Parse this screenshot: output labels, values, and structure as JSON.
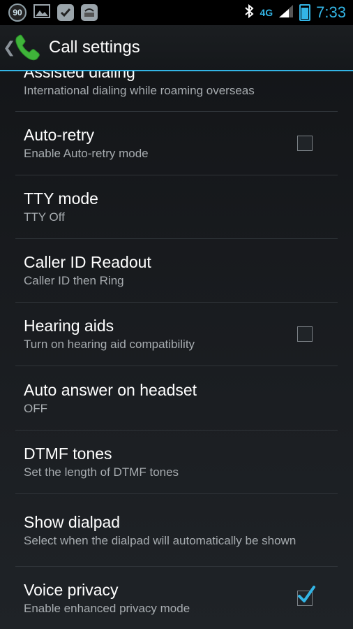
{
  "status_bar": {
    "notification_badge": "90",
    "network_label": "4G",
    "time": "7:33",
    "icons": [
      "counter-badge-icon",
      "gallery-icon",
      "check-bubble-icon",
      "media-app-icon",
      "bluetooth-icon",
      "network-icon",
      "signal-icon",
      "battery-icon"
    ]
  },
  "action_bar": {
    "title": "Call settings",
    "icon": "phone-icon"
  },
  "colors": {
    "accent": "#33b5e5",
    "phone_green": "#3fb43a"
  },
  "settings": [
    {
      "title": "Assisted dialing",
      "subtitle": "International dialing while roaming overseas",
      "checkbox": null
    },
    {
      "title": "Auto-retry",
      "subtitle": "Enable Auto-retry mode",
      "checkbox": false
    },
    {
      "title": "TTY mode",
      "subtitle": "TTY Off",
      "checkbox": null
    },
    {
      "title": "Caller ID Readout",
      "subtitle": "Caller ID then Ring",
      "checkbox": null
    },
    {
      "title": "Hearing aids",
      "subtitle": "Turn on hearing aid compatibility",
      "checkbox": false
    },
    {
      "title": "Auto answer on headset",
      "subtitle": "OFF",
      "checkbox": null
    },
    {
      "title": "DTMF tones",
      "subtitle": "Set the length of DTMF tones",
      "checkbox": null
    },
    {
      "title": "Show dialpad",
      "subtitle": "Select when the dialpad will automatically be shown",
      "checkbox": null
    },
    {
      "title": "Voice privacy",
      "subtitle": "Enable enhanced privacy mode",
      "checkbox": true
    }
  ]
}
